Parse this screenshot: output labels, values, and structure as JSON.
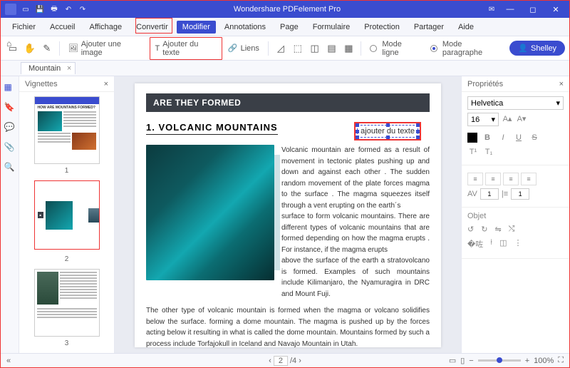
{
  "app": {
    "title": "Wondershare PDFelement Pro"
  },
  "menu": {
    "items": [
      "Fichier",
      "Accueil",
      "Affichage",
      "Convertir",
      "Modifier",
      "Annotations",
      "Page",
      "Formulaire",
      "Protection",
      "Partager",
      "Aide"
    ],
    "activeIndex": 4
  },
  "toolbar": {
    "addImage": "Ajouter une image",
    "addText": "Ajouter du texte",
    "links": "Liens",
    "modeLine": "Mode ligne",
    "modeParagraph": "Mode paragraphe"
  },
  "user": {
    "name": "Shelley"
  },
  "tabs": {
    "file": "Mountain"
  },
  "panels": {
    "thumbnails": "Vignettes",
    "properties": "Propriétés",
    "object": "Objet"
  },
  "thumbs": {
    "count": 3,
    "selected": 2,
    "nums": [
      "1",
      "2",
      "3"
    ],
    "t1title": "HOW ARE MOUNTAINS FORMED?"
  },
  "doc": {
    "band": "ARE THEY FORMED",
    "heading": "1. VOLCANIC MOUNTAINS",
    "addPlaceholder": "ajouter du texte",
    "col": "Volcanic mountain are formed as a result of movement in tectonic plates pushing up and down and against each other . The sudden random movement  of the plate forces magma  to the surface . The magma squeezes itself through a vent erupting on the earth´s\nsurface to form volcanic mountains. There are different types of volcanic mountains that are formed depending  on how the magma erupts . For instance, if the magma erupts\nabove the surface of the earth a stratovolcano is formed. Examples of such mountains include Kilimanjaro, the Nyamuragira in DRC and Mount Fuji.",
    "full": "The other type of volcanic mountain is formed when the magma or volcano solidifies below the surface. forming a dome mountain. The magma is pushed up by the forces acting below it resulting in what is called the dome mountain. Mountains formed by such a process include Torfajokull in Iceland and Navajo Mountain in Utah."
  },
  "props": {
    "font": "Helvetica",
    "size": "16",
    "spacing1": "1",
    "spacing2": "1"
  },
  "status": {
    "page": "2",
    "total": "/4",
    "zoom": "100%"
  }
}
